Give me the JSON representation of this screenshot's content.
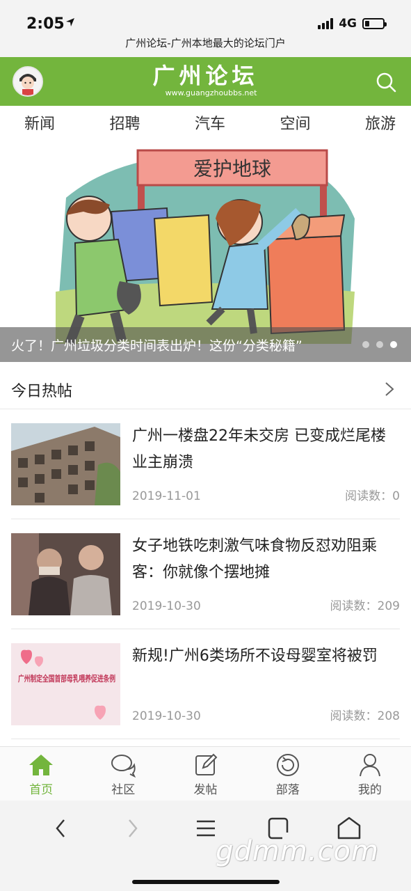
{
  "status": {
    "time": "2:05",
    "network": "4G"
  },
  "page_title": "广州论坛-广州本地最大的论坛门户",
  "header": {
    "logo_main": "广州论坛",
    "logo_sub": "www.guangzhoubbs.net",
    "brand_color": "#73b53d"
  },
  "tabs": [
    {
      "label": "新闻"
    },
    {
      "label": "招聘"
    },
    {
      "label": "汽车"
    },
    {
      "label": "空间"
    },
    {
      "label": "旅游"
    }
  ],
  "banner": {
    "sign_text": "爱护地球",
    "caption": "火了！广州垃圾分类时间表出炉！这份“分类秘籍”",
    "slide_count": 3,
    "active_slide": 3
  },
  "hot": {
    "title": "今日热帖"
  },
  "posts": [
    {
      "title": "广州一楼盘22年未交房 已变成烂尾楼 业主崩溃",
      "date": "2019-11-01",
      "reads": "阅读数：0"
    },
    {
      "title": "女子地铁吃刺激气味食物反怼劝阻乘客：你就像个摆地摊",
      "date": "2019-10-30",
      "reads": "阅读数：209"
    },
    {
      "title": "新规!广州6类场所不设母婴室将被罚",
      "date": "2019-10-30",
      "reads": "阅读数：208",
      "thumb_text": "广州制定全国首部母乳喂养促进条例"
    }
  ],
  "tabbar": [
    {
      "label": "首页",
      "icon": "home-icon",
      "active": true
    },
    {
      "label": "社区",
      "icon": "chat-icon",
      "active": false
    },
    {
      "label": "发帖",
      "icon": "edit-icon",
      "active": false
    },
    {
      "label": "部落",
      "icon": "refresh-circle-icon",
      "active": false
    },
    {
      "label": "我的",
      "icon": "user-icon",
      "active": false
    }
  ],
  "watermark": "gdmm.com"
}
